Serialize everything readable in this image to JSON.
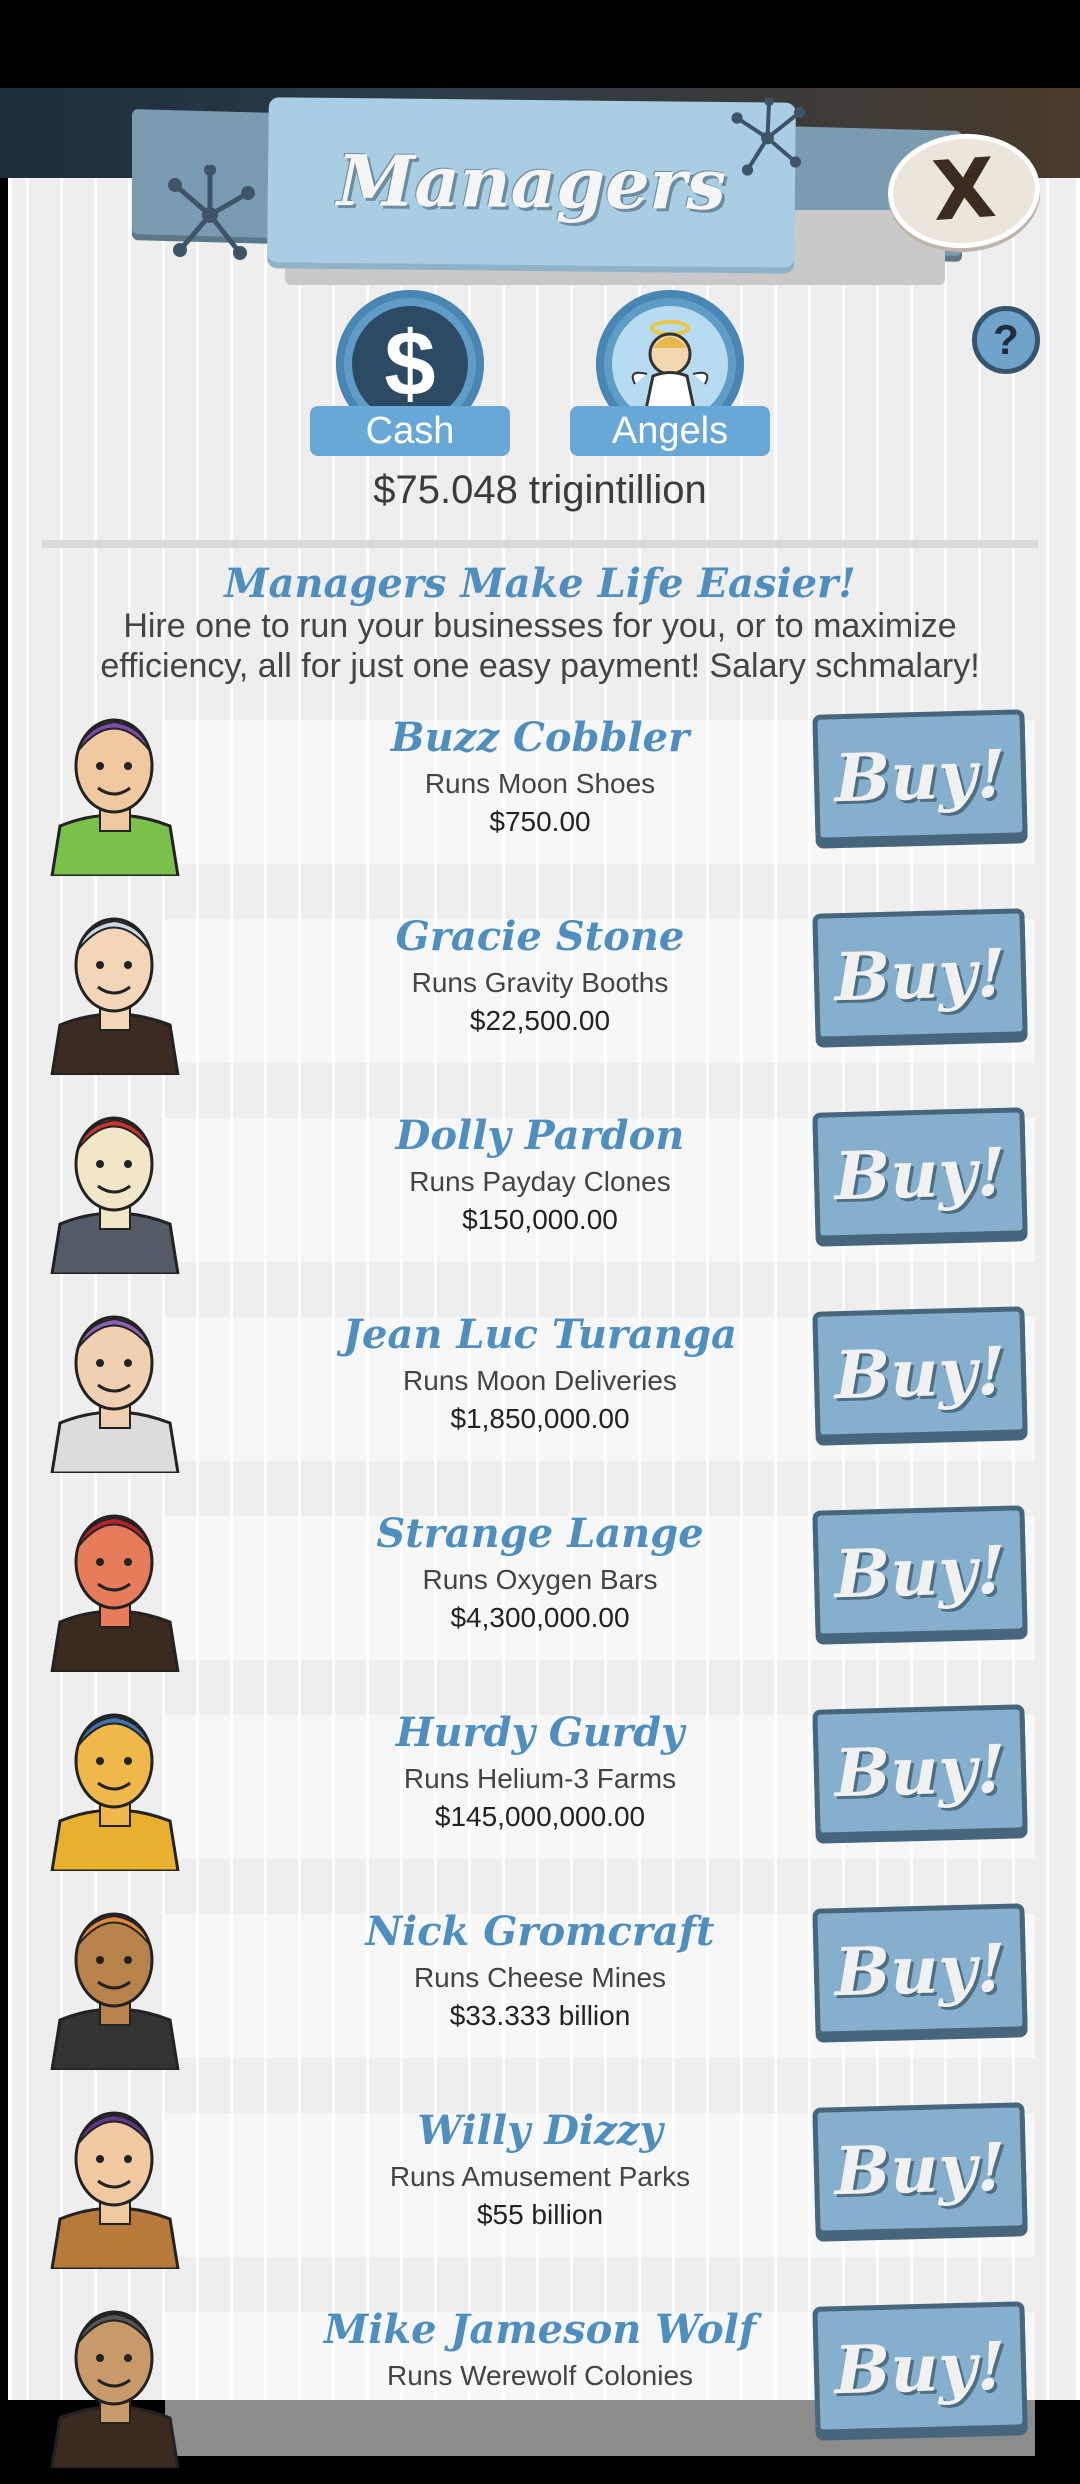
{
  "header": {
    "title": "Managers",
    "close_label": "X",
    "help_label": "?"
  },
  "tabs": [
    {
      "label": "Cash",
      "icon": "dollar-sign-icon",
      "symbol": "$"
    },
    {
      "label": "Angels",
      "icon": "angel-icon"
    }
  ],
  "cash_amount": "$75.048 trigintillion",
  "promo": {
    "title": "Managers Make Life Easier!",
    "body": "Hire one to run your businesses for you, or to maximize efficiency, all for just one easy payment! Salary schmalary!"
  },
  "managers": [
    {
      "name": "Buzz Cobbler",
      "runs": "Runs Moon Shoes",
      "cost": "$750.00",
      "buy_label": "Buy!"
    },
    {
      "name": "Gracie Stone",
      "runs": "Runs Gravity Booths",
      "cost": "$22,500.00",
      "buy_label": "Buy!"
    },
    {
      "name": "Dolly Pardon",
      "runs": "Runs Payday Clones",
      "cost": "$150,000.00",
      "buy_label": "Buy!"
    },
    {
      "name": "Jean Luc Turanga",
      "runs": "Runs Moon Deliveries",
      "cost": "$1,850,000.00",
      "buy_label": "Buy!"
    },
    {
      "name": "Strange Lange",
      "runs": "Runs Oxygen Bars",
      "cost": "$4,300,000.00",
      "buy_label": "Buy!"
    },
    {
      "name": "Hurdy Gurdy",
      "runs": "Runs Helium-3 Farms",
      "cost": "$145,000,000.00",
      "buy_label": "Buy!"
    },
    {
      "name": "Nick Gromcraft",
      "runs": "Runs Cheese Mines",
      "cost": "$33.333 billion",
      "buy_label": "Buy!"
    },
    {
      "name": "Willy Dizzy",
      "runs": "Runs Amusement Parks",
      "cost": "$55 billion",
      "buy_label": "Buy!"
    },
    {
      "name": "Mike Jameson Wolf",
      "runs": "Runs Werewolf Colonies",
      "cost": "",
      "buy_label": "Buy!"
    }
  ],
  "colors": {
    "accent": "#4f8fc0",
    "button": "#85afcc",
    "panel": "#eeeeee"
  }
}
